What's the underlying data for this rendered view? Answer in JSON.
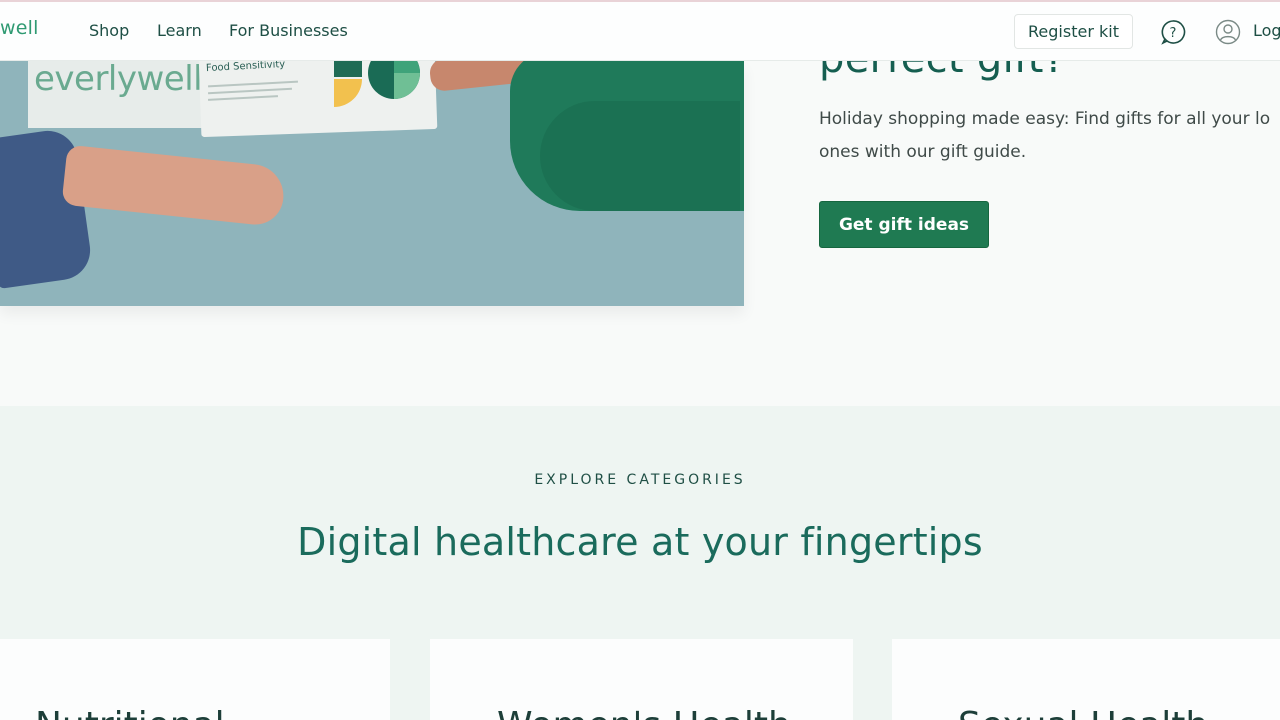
{
  "nav": {
    "logo_text": "well",
    "links": [
      "Shop",
      "Learn",
      "For Businesses"
    ],
    "register_label": "Register kit",
    "login_label": "Log",
    "help_icon": "help-circle-icon",
    "account_icon": "user-account-icon"
  },
  "hero": {
    "box_logo": "everlywell",
    "card_title": "Food Sensitivity",
    "heading": "perfect gift?",
    "text_line1": "Holiday shopping made easy: Find gifts for all your lo",
    "text_line2": "ones with our gift guide.",
    "button_label": "Get gift ideas"
  },
  "categories": {
    "eyebrow": "EXPLORE CATEGORIES",
    "title": "Digital healthcare at your fingertips",
    "cards": [
      {
        "title": "Nutritional"
      },
      {
        "title": "Women's Health"
      },
      {
        "title": "Sexual Health"
      }
    ]
  },
  "colors": {
    "brand_green": "#1f7a52",
    "heading_teal": "#155e50",
    "hero_bg": "#8fb4bb",
    "section_bg": "#eef5f2"
  }
}
